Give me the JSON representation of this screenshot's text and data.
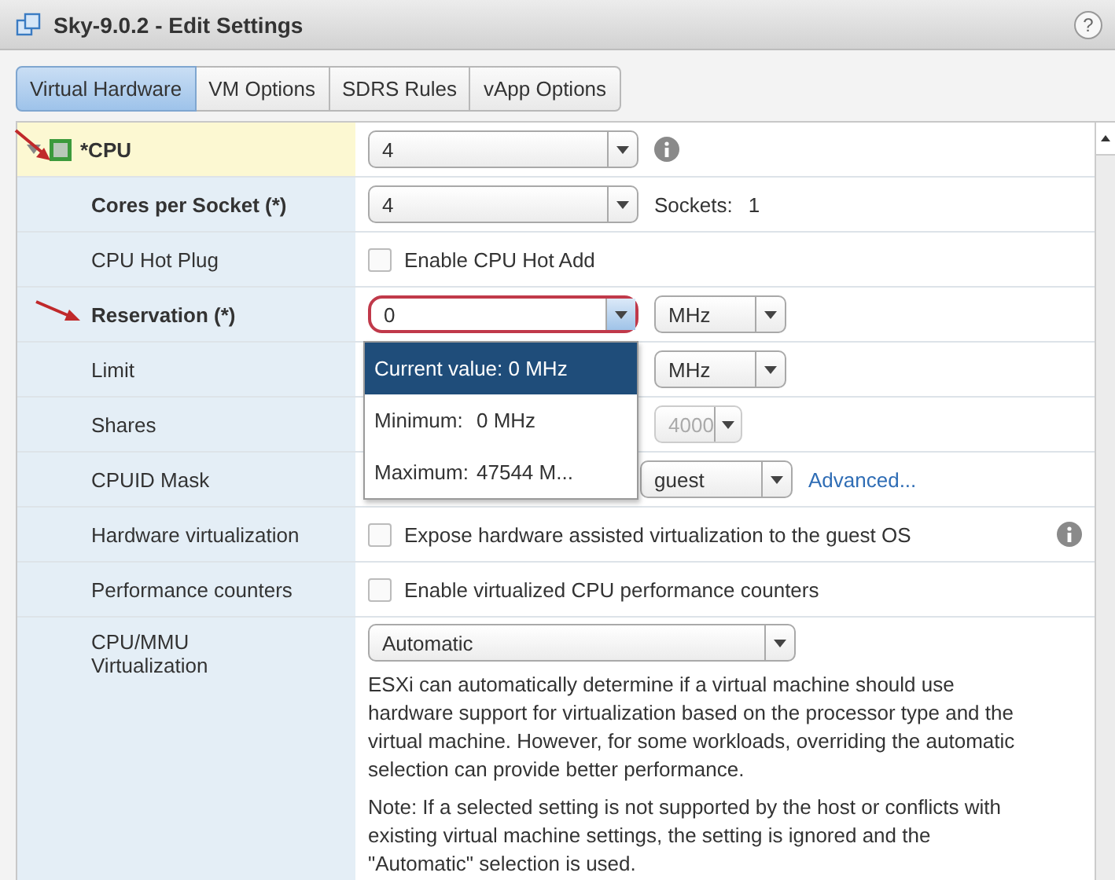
{
  "window": {
    "title": "Sky-9.0.2 - Edit Settings",
    "help": "?"
  },
  "tabs": [
    {
      "label": "Virtual Hardware",
      "selected": true
    },
    {
      "label": "VM Options",
      "selected": false
    },
    {
      "label": "SDRS Rules",
      "selected": false
    },
    {
      "label": "vApp Options",
      "selected": false
    }
  ],
  "rows": [
    {
      "kind": "dropdown",
      "label": "*CPU",
      "bold": true,
      "selected": true,
      "expanded": true,
      "value": "4",
      "info": true
    },
    {
      "kind": "dropdown",
      "label": "Cores per Socket (*)",
      "bold": true,
      "selected": false,
      "value": "4",
      "note_label": "Sockets:",
      "note_value": "1"
    },
    {
      "kind": "checkbox",
      "label": "CPU Hot Plug",
      "bold": false,
      "selected": false,
      "text": "Enable CPU Hot Add",
      "checked": false
    },
    {
      "kind": "combo",
      "label": "Reservation (*)",
      "bold": true,
      "selected": false,
      "value": "0",
      "focused": true,
      "unit": "MHz",
      "popup": {
        "current": "Current value: 0 MHz",
        "items": [
          {
            "label": "Minimum:",
            "value": "0 MHz"
          },
          {
            "label": "Maximum:",
            "value": "47544 M..."
          }
        ]
      }
    },
    {
      "kind": "unit",
      "label": "Limit",
      "bold": false,
      "selected": false,
      "unit": "MHz"
    },
    {
      "kind": "shares",
      "label": "Shares",
      "bold": false,
      "selected": false,
      "value": "4000",
      "disabled": true
    },
    {
      "kind": "mask",
      "label": "CPUID Mask",
      "bold": false,
      "selected": false,
      "value": "guest",
      "link": "Advanced..."
    },
    {
      "kind": "checkbox",
      "label": "Hardware virtualization",
      "bold": false,
      "selected": false,
      "text": "Expose hardware assisted virtualization to the guest OS",
      "checked": false,
      "info": true
    },
    {
      "kind": "checkbox",
      "label": "Performance counters",
      "bold": false,
      "selected": false,
      "text": "Enable virtualized CPU performance counters",
      "checked": false
    },
    {
      "kind": "mmu",
      "label": "CPU/MMU Virtualization",
      "bold": false,
      "selected": false,
      "value": "Automatic",
      "paragraphs": [
        "ESXi can automatically determine if a virtual machine should use hardware support for virtualization based on the processor type and the virtual machine. However, for some workloads, overriding the automatic selection can provide better performance.",
        "Note: If a selected setting is not supported by the host or conflicts with existing virtual machine settings, the setting is ignored and the \"Automatic\" selection is used."
      ]
    }
  ]
}
